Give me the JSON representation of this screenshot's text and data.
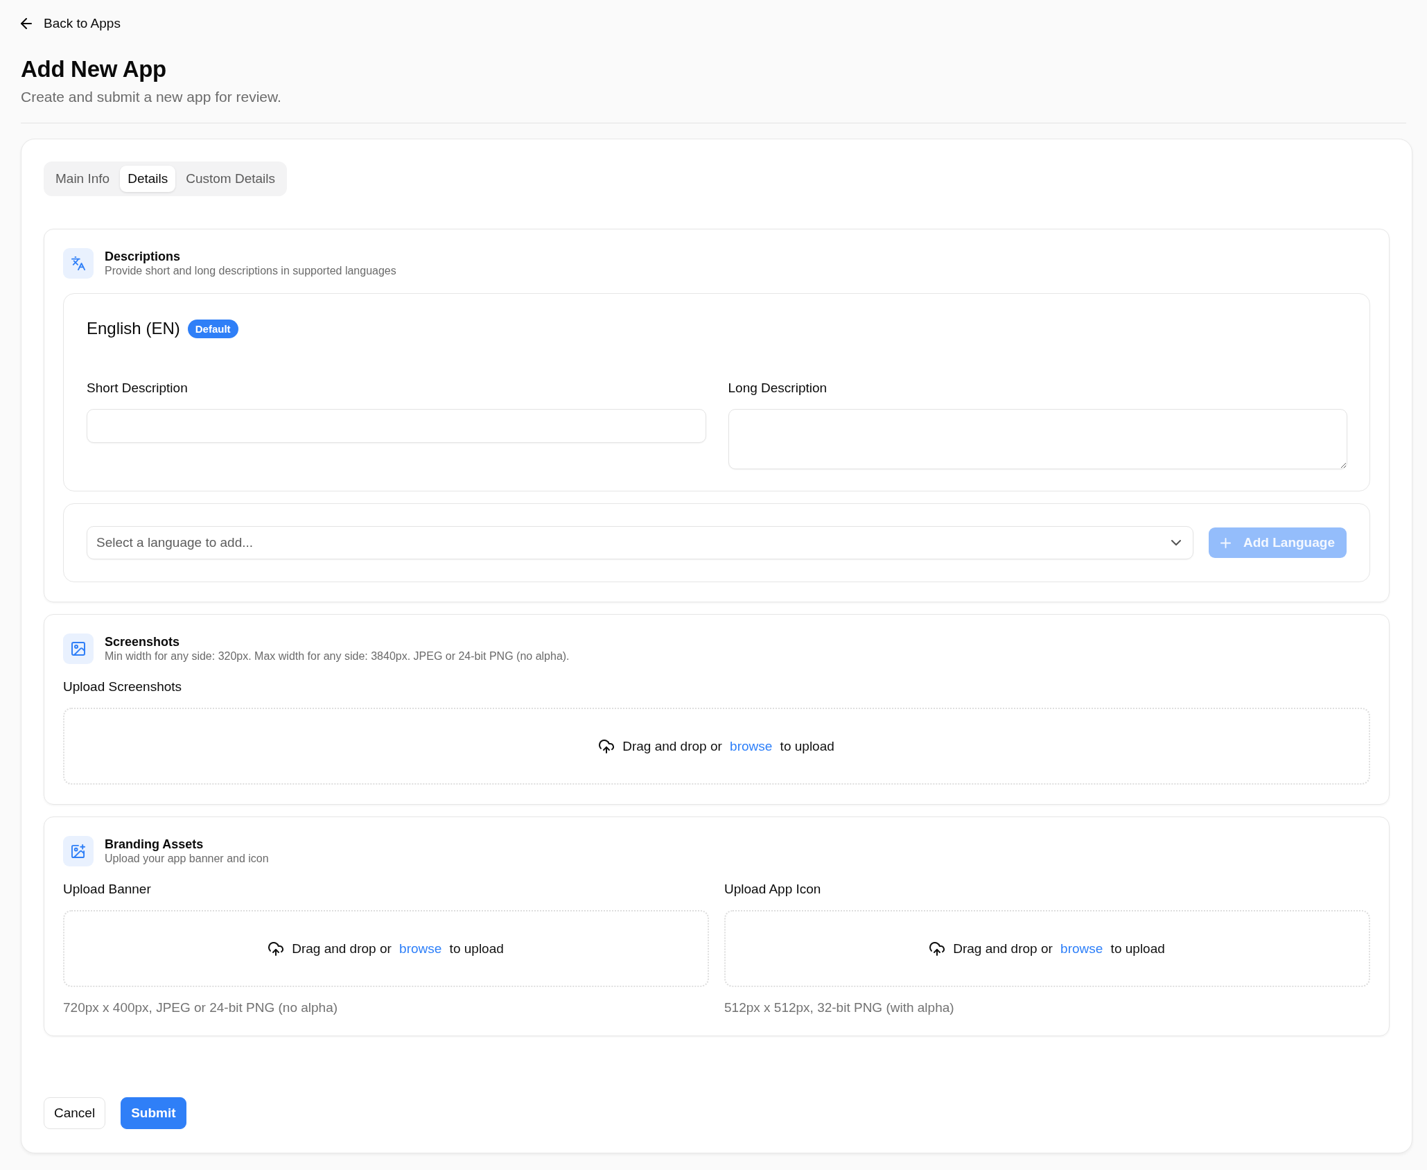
{
  "back_link": {
    "label": "Back to Apps"
  },
  "header": {
    "title": "Add New App",
    "subtitle": "Create and submit a new app for review."
  },
  "tabs": [
    {
      "label": "Main Info",
      "selected": false
    },
    {
      "label": "Details",
      "selected": true
    },
    {
      "label": "Custom Details",
      "selected": false
    }
  ],
  "sections": [
    {
      "kind": "descriptions",
      "title": "Descriptions",
      "subtitle": "Provide short and long descriptions in supported languages",
      "languages": [
        {
          "name": "English (EN)",
          "badge": "Default",
          "fields": [
            {
              "kind": "input",
              "label": "Short Description"
            },
            {
              "kind": "textarea",
              "label": "Long Description"
            }
          ]
        }
      ],
      "add_language": {
        "select": {
          "placeholder": "Select a language to add..."
        },
        "button": {
          "label": "Add Language",
          "disabled": true
        }
      }
    },
    {
      "kind": "screenshots",
      "title": "Screenshots",
      "subtitle": "Min width for any side: 320px. Max width for any side: 3840px. JPEG or 24-bit PNG (no alpha).",
      "uploads": [
        {
          "label": "Upload Screenshots",
          "prompt": "Drag and drop or",
          "link": "browse",
          "suffix": "to upload"
        }
      ]
    },
    {
      "kind": "branding",
      "title": "Branding Assets",
      "subtitle": "Upload your app banner and icon",
      "uploads": [
        {
          "label": "Upload Banner",
          "prompt": "Drag and drop or",
          "link": "browse",
          "suffix": "to upload",
          "hint": "720px x 400px, JPEG or 24-bit PNG (no alpha)"
        },
        {
          "label": "Upload App Icon",
          "prompt": "Drag and drop or",
          "link": "browse",
          "suffix": "to upload",
          "hint": "512px x 512px, 32-bit PNG (with alpha)"
        }
      ]
    }
  ],
  "actions": [
    {
      "kind": "secondary",
      "label": "Cancel"
    },
    {
      "kind": "primary",
      "label": "Submit"
    }
  ]
}
